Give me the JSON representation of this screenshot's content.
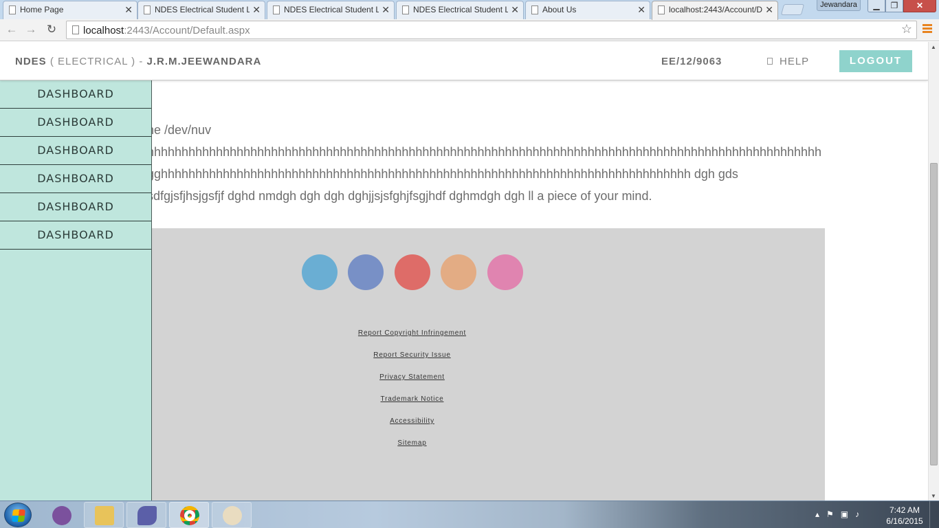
{
  "browser": {
    "tabs": [
      {
        "label": "Home Page"
      },
      {
        "label": "NDES Electrical Student L"
      },
      {
        "label": "NDES Electrical Student L"
      },
      {
        "label": "NDES Electrical Student L"
      },
      {
        "label": "About Us"
      },
      {
        "label": "localhost:2443/Account/D"
      }
    ],
    "user_badge": "Jewandara",
    "url_host": "localhost",
    "url_rest": ":2443/Account/Default.aspx"
  },
  "header": {
    "brand_prefix": "NDES",
    "brand_dept": " ( ELECTRICAL ) - ",
    "brand_name": "J.R.M.JEEWANDARA",
    "reg_no": "EE/12/9063",
    "help_label": "HELP",
    "logout_label": "LOGOUT"
  },
  "sidebar": {
    "items": [
      {
        "label": "DASHBOARD"
      },
      {
        "label": "DASHBOARD"
      },
      {
        "label": "DASHBOARD"
      },
      {
        "label": "DASHBOARD"
      },
      {
        "label": "DASHBOARD"
      },
      {
        "label": "DASHBOARD"
      }
    ]
  },
  "main": {
    "lines": [
      "ne /dev/nuv",
      "hhhhhhhhhhhhhhhhhhhhhhhhhhhhhhhhhhhhhhhhhhhhhhhhhhhhhhhhhhhhhhhhhhhhhhhhhhhhhhhhhhhhhhhhhhhhhhhhhh",
      "gghhhhhhhhhhhhhhhhhhhhhhhhhhhhhhhhhhhhhhhhhhhhhhhhhhhhhhhhhhhhhhhhhhhhhhhhhhhhh dgh gds",
      "sdfgjsfjhsjgsfjf dghd nmdgh dgh dgh dghjjsjsfghjfsgjhdf dghmdgh dgh ll a piece of your mind."
    ]
  },
  "footer": {
    "social_colors": [
      "#6aaed3",
      "#7890c6",
      "#de6c68",
      "#e3ac84",
      "#e084b0"
    ],
    "links": [
      "Report Copyright Infringement",
      "Report Security Issue",
      "Privacy Statement",
      "Trademark Notice",
      "Accessibility",
      "Sitemap"
    ]
  },
  "taskbar": {
    "time": "7:42 AM",
    "date": "6/16/2015"
  },
  "colors": {
    "accent": "#8fd3cc",
    "sidebar_bg": "#bfe6dd",
    "footer_bg": "#d3d3d3"
  }
}
